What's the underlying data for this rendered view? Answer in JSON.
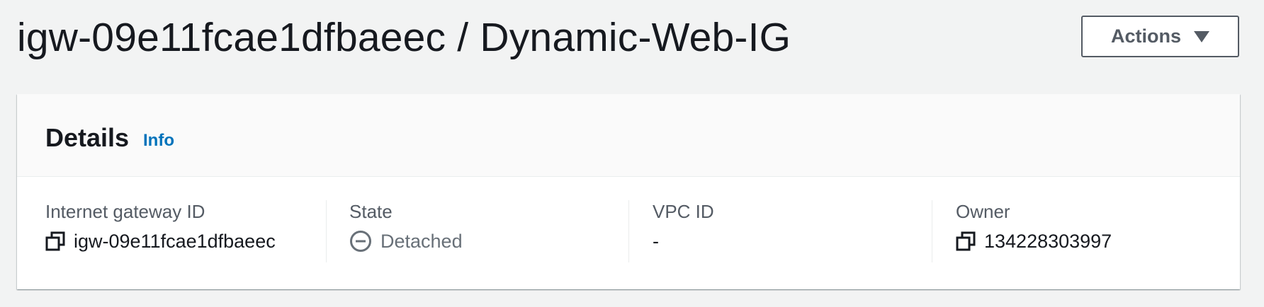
{
  "header": {
    "title": "igw-09e11fcae1dfbaeec / Dynamic-Web-IG",
    "actions_label": "Actions"
  },
  "details": {
    "title": "Details",
    "info_label": "Info",
    "fields": [
      {
        "label": "Internet gateway ID",
        "value": "igw-09e11fcae1dfbaeec",
        "icon": "copy-icon"
      },
      {
        "label": "State",
        "value": "Detached",
        "icon": "minus-circle-icon"
      },
      {
        "label": "VPC ID",
        "value": "-"
      },
      {
        "label": "Owner",
        "value": "134228303997",
        "icon": "copy-icon"
      }
    ]
  },
  "colors": {
    "background": "#f2f3f3",
    "link": "#0073bb",
    "text": "#16191f",
    "muted": "#545b64"
  }
}
